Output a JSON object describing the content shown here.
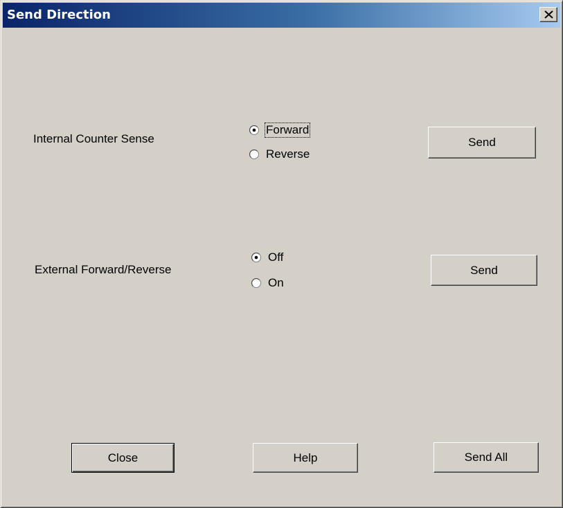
{
  "window": {
    "title": "Send Direction",
    "close_glyph": "X"
  },
  "internal_counter": {
    "label": "Internal Counter Sense",
    "options": [
      {
        "label": "Forward",
        "selected": true,
        "focused": true
      },
      {
        "label": "Reverse",
        "selected": false,
        "focused": false
      }
    ],
    "send_label": "Send"
  },
  "external_fr": {
    "label": "External Forward/Reverse",
    "options": [
      {
        "label": "Off",
        "selected": true,
        "focused": false
      },
      {
        "label": "On",
        "selected": false,
        "focused": false
      }
    ],
    "send_label": "Send"
  },
  "footer": {
    "close_label": "Close",
    "help_label": "Help",
    "send_all_label": "Send All"
  },
  "colors": {
    "face": "#d4d0c8",
    "title_start": "#0a246a",
    "title_end": "#a6caf0"
  },
  "icons": {
    "close": "close-icon",
    "radio_selected": "radio-selected-icon",
    "radio_unselected": "radio-unselected-icon"
  }
}
